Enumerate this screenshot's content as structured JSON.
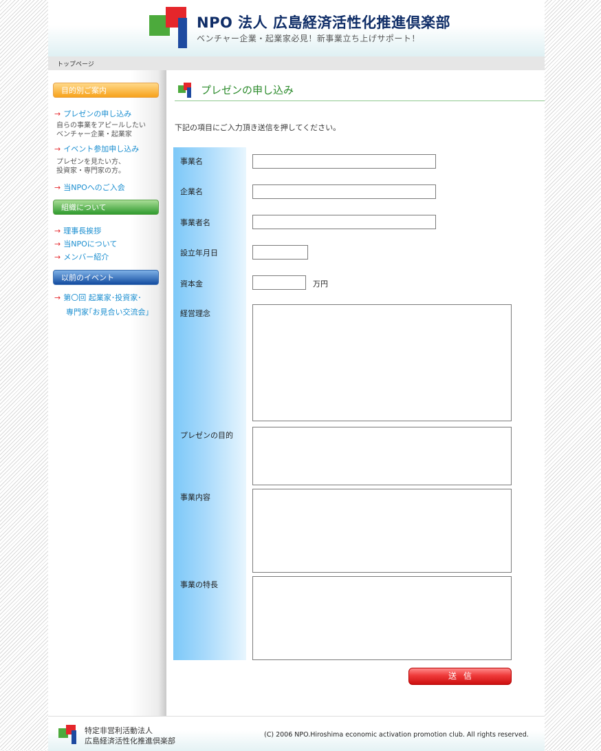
{
  "header": {
    "title": "NPO 法人 広島経済活性化推進倶楽部",
    "subtitle": "ベンチャー企業・起業家必見！新事業立ち上げサポート！"
  },
  "breadcrumb": "トップページ",
  "sidebar": {
    "section1": "目的別ご案内",
    "link_presentation": "プレゼンの申し込み",
    "desc_presentation_1": "自らの事業をアピールしたい",
    "desc_presentation_2": "ベンチャー企業・起業家",
    "link_event": "イベント参加申し込み",
    "desc_event_1": "プレゼンを見たい方、",
    "desc_event_2": "投資家・専門家の方。",
    "link_join": "当NPOへのご入会",
    "section2": "組織について",
    "link_greeting": "理事長挨拶",
    "link_about": "当NPOについて",
    "link_members": "メンバー紹介",
    "section3": "以前のイベント",
    "link_past_event_1": "第〇回 起業家･投資家･",
    "link_past_event_2": "専門家｢お見合い交流会｣",
    "arrow": "→"
  },
  "main": {
    "title": "プレゼンの申し込み",
    "intro": "下記の項目にご入力頂き送信を押してください。",
    "labels": {
      "business_name": "事業名",
      "company_name": "企業名",
      "operator_name": "事業者名",
      "established": "設立年月日",
      "capital": "資本金",
      "philosophy": "経営理念",
      "purpose": "プレゼンの目的",
      "content": "事業内容",
      "features": "事業の特長"
    },
    "values": {
      "business_name": "",
      "company_name": "",
      "operator_name": "",
      "established": "",
      "capital": "",
      "philosophy": "",
      "purpose": "",
      "content": "",
      "features": ""
    },
    "capital_unit": "万円",
    "submit_label": "送信"
  },
  "footer": {
    "org_line1": "特定非営利活動法人",
    "org_line2": "広島経済活性化推進倶楽部",
    "copyright": "(C) 2006  NPO.Hiroshima economic activation promotion club. All rights reserved."
  },
  "colors": {
    "link": "#1a8ed0",
    "arrow": "#e5262b",
    "title_navy": "#0f2d67",
    "heading_green": "#2a8a2a",
    "submit_red": "#ef3a3a"
  }
}
